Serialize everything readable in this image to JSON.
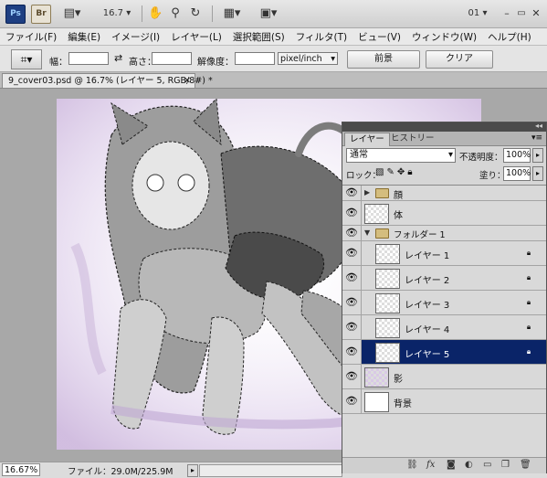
{
  "appbar": {
    "ps_logo": "Ps",
    "br_logo": "Br",
    "zoom_value": "16.7",
    "workspace": "01",
    "icons": [
      "film-icon",
      "hand-icon",
      "zoom-icon",
      "rotate-icon",
      "arrange-icon",
      "screen-mode-icon"
    ]
  },
  "menu": [
    "ファイル(F)",
    "編集(E)",
    "イメージ(I)",
    "レイヤー(L)",
    "選択範囲(S)",
    "フィルタ(T)",
    "ビュー(V)",
    "ウィンドウ(W)",
    "ヘルプ(H)"
  ],
  "options": {
    "width_label": "幅：",
    "height_label": "高さ：",
    "resolution_label": "解像度：",
    "unit": "pixel/inch",
    "front_button": "前景",
    "clear_button": "クリア"
  },
  "document": {
    "tab_title": "9_cover03.psd @ 16.7% (レイヤー 5, RGB/8#) *"
  },
  "status": {
    "zoom": "16.67%",
    "file_info": "ファイル：29.0M/225.9M"
  },
  "layers_panel": {
    "tabs": [
      "レイヤー",
      "ヒストリー"
    ],
    "blend_mode": "通常",
    "opacity_label": "不透明度：",
    "opacity_value": "100%",
    "lock_label": "ロック：",
    "fill_label": "塗り：",
    "fill_value": "100%",
    "layers": [
      {
        "name": "顔",
        "type": "group",
        "collapsed": true,
        "indent": 0
      },
      {
        "name": "体",
        "type": "layer",
        "indent": 0
      },
      {
        "name": "フォルダー 1",
        "type": "group",
        "collapsed": false,
        "indent": 0
      },
      {
        "name": "レイヤー 1",
        "type": "layer",
        "indent": 1,
        "locked": true
      },
      {
        "name": "レイヤー 2",
        "type": "layer",
        "indent": 1,
        "locked": true
      },
      {
        "name": "レイヤー 3",
        "type": "layer",
        "indent": 1,
        "locked": true
      },
      {
        "name": "レイヤー 4",
        "type": "layer",
        "indent": 1,
        "locked": true
      },
      {
        "name": "レイヤー 5",
        "type": "layer",
        "indent": 1,
        "locked": true,
        "selected": true
      },
      {
        "name": "影",
        "type": "layer",
        "indent": 0
      },
      {
        "name": "背景",
        "type": "layer",
        "indent": 0,
        "white": true
      }
    ]
  },
  "colors": {
    "selected_layer": "#0a2468",
    "canvas_tint": "#b79fcf"
  }
}
